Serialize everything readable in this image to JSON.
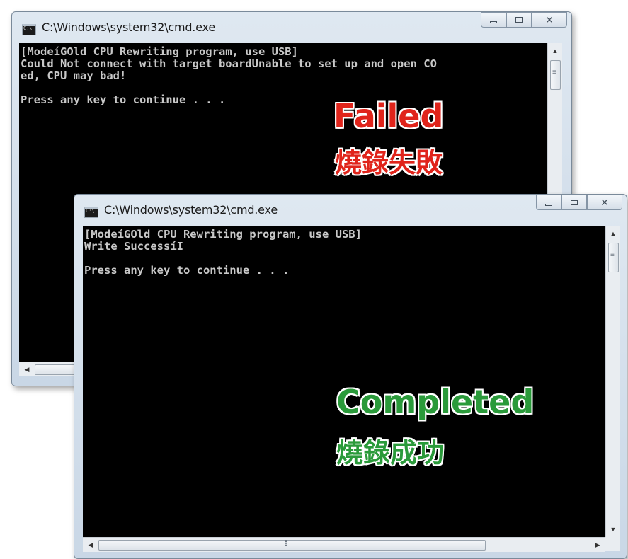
{
  "window_failed": {
    "title": "C:\\Windows\\system32\\cmd.exe",
    "console_lines": "[ModeíGOld CPU Rewriting program, use USB]\nCould Not connect with target boardUnable to set up and open CO\ned, CPU may bad!\n\nPress any key to continue . . .",
    "overlay_en": "Failed",
    "overlay_zh": "燒錄失敗",
    "overlay_color": "#e0241b"
  },
  "window_completed": {
    "title": "C:\\Windows\\system32\\cmd.exe",
    "console_lines": "[ModeíGOld CPU Rewriting program, use USB]\nWrite SuccessíI\n\nPress any key to continue . . .",
    "overlay_en": "Completed",
    "overlay_zh": "燒錄成功",
    "overlay_color": "#2a9a3a"
  },
  "controls": {
    "minimize_icon": "minimize-icon",
    "maximize_icon": "maximize-icon",
    "close_glyph": "✕"
  }
}
